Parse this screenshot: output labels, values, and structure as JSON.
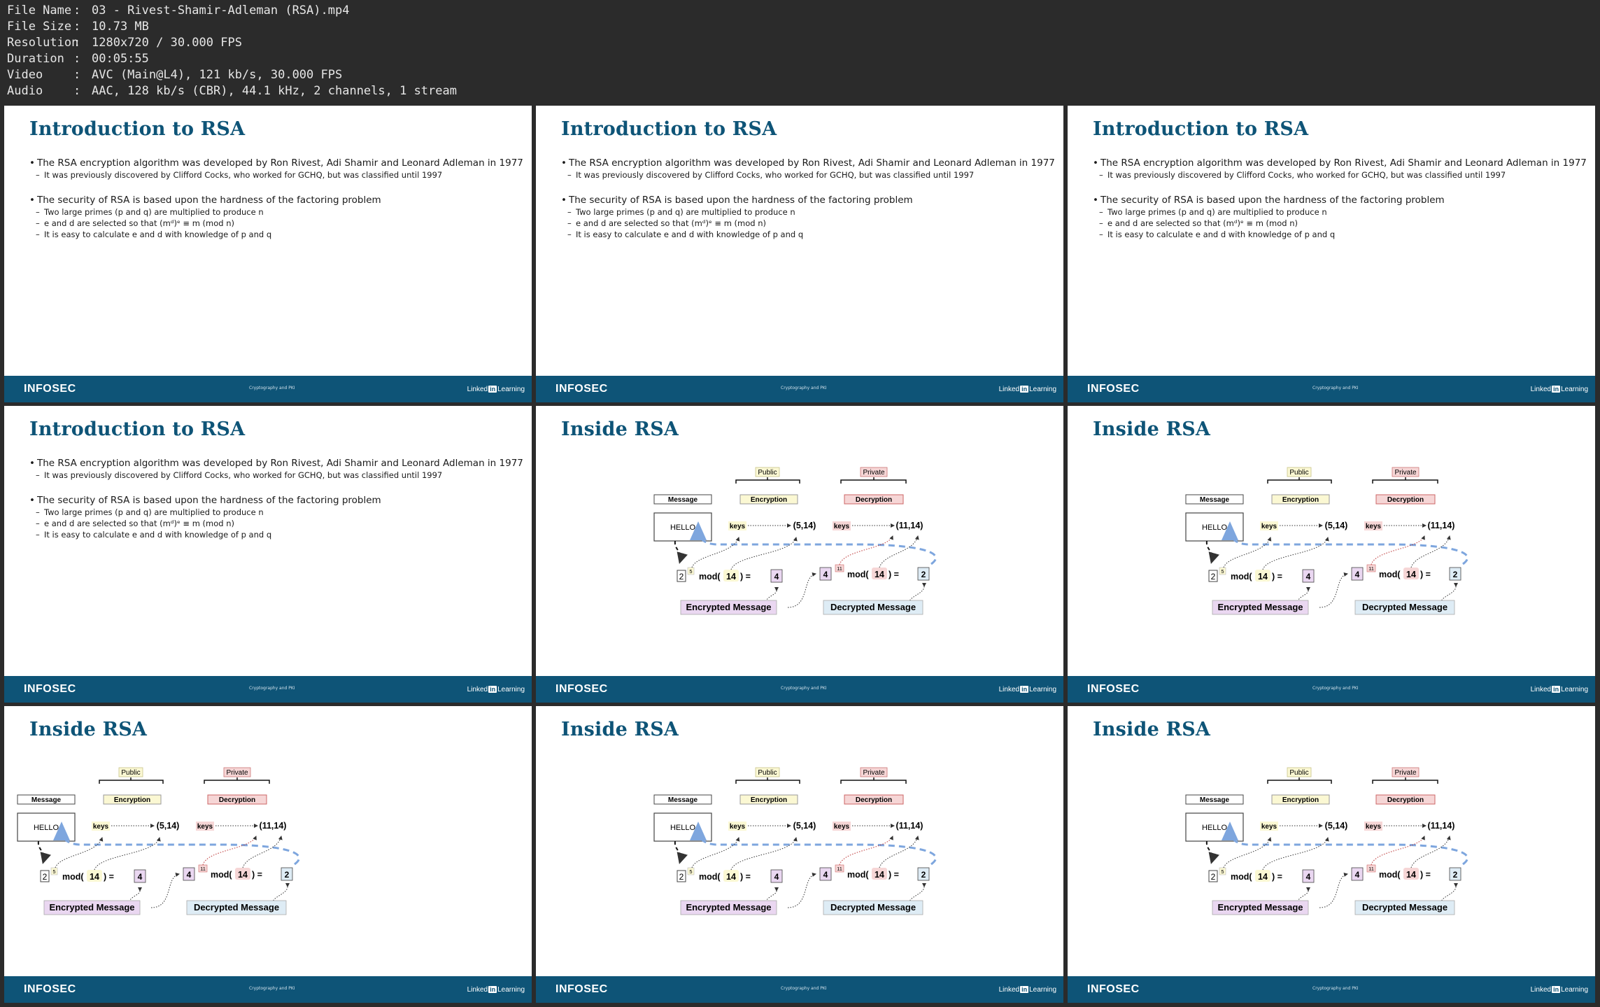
{
  "file_info": [
    {
      "key": "File Name",
      "value": "03 - Rivest-Shamir-Adleman (RSA).mp4"
    },
    {
      "key": "File Size",
      "value": "10.73 MB"
    },
    {
      "key": "Resolution",
      "value": "1280x720 / 30.000 FPS"
    },
    {
      "key": "Duration",
      "value": "00:05:55"
    },
    {
      "key": "Video",
      "value": "AVC (Main@L4), 121 kb/s, 30.000 FPS"
    },
    {
      "key": "Audio",
      "value": "AAC, 128 kb/s (CBR), 44.1 kHz, 2 channels, 1 stream"
    }
  ],
  "footer": {
    "brand": "INFOSEC",
    "course": "Cryptography and PKI",
    "linkedin_pre": "Linked",
    "linkedin_in": "in",
    "linkedin_post": "Learning"
  },
  "slide_intro": {
    "title": "Introduction to RSA",
    "b1": "The RSA encryption algorithm was developed by Ron Rivest, Adi Shamir and Leonard Adleman in 1977",
    "b1_sub": "It was previously discovered by Clifford Cocks, who worked for GCHQ, but was classified until 1997",
    "b2": "The security of RSA is based upon the hardness of the factoring problem",
    "b2_sub1": "Two large primes (p and q) are multiplied to produce n",
    "b2_sub2": "e and d are selected so that (mᵈ)ᵉ ≡ m (mod n)",
    "b2_sub3": "It is easy to calculate e and d with knowledge of p and q"
  },
  "slide_inside": {
    "title": "Inside RSA",
    "public": "Public",
    "private": "Private",
    "message": "Message",
    "encryption": "Encryption",
    "decryption": "Decryption",
    "hello": "HELLO",
    "keys": "keys",
    "pub_key": "(5,14)",
    "priv_key": "(11,14)",
    "m_val": "2",
    "e_exp": "5",
    "mod_pre": "mod(",
    "mod_n": "14",
    "mod_post": ") =",
    "c_val": "4",
    "c_val2": "4",
    "d_exp": "11",
    "mod_n2": "14",
    "dec_val": "2",
    "encrypted_message": "Encrypted Message",
    "decrypted_message": "Decrypted Message"
  },
  "thumbnails": [
    "intro",
    "intro",
    "intro",
    "intro",
    "inside",
    "inside",
    "inside",
    "inside",
    "inside"
  ],
  "colors": {
    "accent": "#0e5477",
    "background": "#2b2b2b",
    "public_fill": "#fbf8d3",
    "private_fill": "#f6d6d6",
    "encrypted_fill": "#ead7f1",
    "decrypted_fill": "#deecf5",
    "dashed_arrow": "#7ea6de"
  }
}
